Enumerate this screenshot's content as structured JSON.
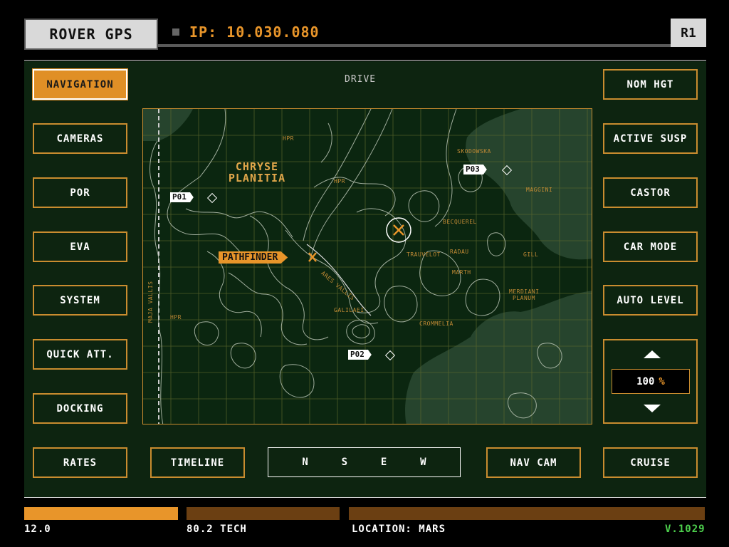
{
  "header": {
    "title": "ROVER GPS",
    "ip": "IP: 10.030.080",
    "badge": "R1"
  },
  "left_menu": [
    "NAVIGATION",
    "CAMERAS",
    "POR",
    "EVA",
    "SYSTEM",
    "QUICK ATT.",
    "DOCKING",
    "RATES"
  ],
  "active_menu": "NAVIGATION",
  "right_menu": [
    "NOM HGT",
    "ACTIVE SUSP",
    "CASTOR",
    "CAR MODE",
    "AUTO LEVEL",
    "CRUISE"
  ],
  "map": {
    "mode_label": "DRIVE",
    "region_name_line1": "CHRYSE",
    "region_name_line2": "PLANITIA",
    "markers": {
      "p01": "P01",
      "p02": "P02",
      "p03": "P03",
      "pathfinder": "PATHFINDER"
    },
    "labels": {
      "hpr1": "HPR",
      "hpr2": "HPR",
      "hpr3": "HPR",
      "skodowska": "SKODOWSKA",
      "maggini": "MAGGINI",
      "becquerel": "BECQUEREL",
      "trauvelot": "TRAUVELOT",
      "radau": "RADAU",
      "gill": "GILL",
      "marth": "MARTH",
      "meridiani1": "MERDIANI",
      "meridiani2": "PLANUM",
      "galilaei": "GALILAEI",
      "crommelin": "CROMMELIA",
      "ares": "ARES VALLIS",
      "maja": "MAJA VALLIS"
    }
  },
  "bottom_buttons": {
    "timeline": "TIMELINE",
    "nav_cam": "NAV CAM"
  },
  "compass": [
    "N",
    "S",
    "E",
    "W"
  ],
  "height_control": {
    "value": "100",
    "unit": "%"
  },
  "footer": {
    "left": "12.0",
    "tech": "80.2 TECH",
    "location": "LOCATION: MARS",
    "version": "V.1029",
    "bar_left_progress": 1.0,
    "colors": {
      "accent": "#e8952a",
      "dark_accent": "#6b3f12",
      "version": "#4dd04d"
    }
  }
}
